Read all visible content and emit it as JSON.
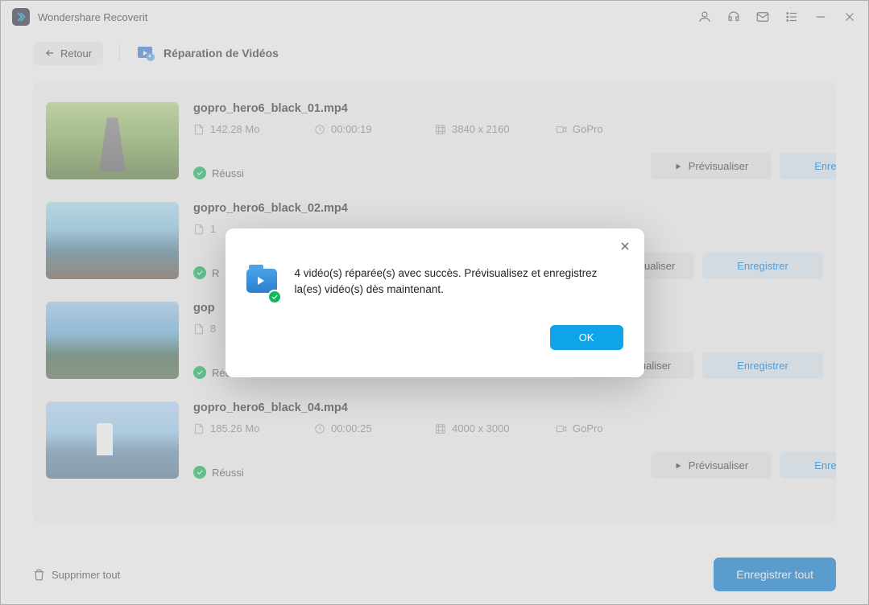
{
  "app": {
    "title": "Wondershare Recoverit"
  },
  "nav": {
    "back": "Retour",
    "title": "Réparation de Vidéos"
  },
  "labels": {
    "preview": "Prévisualiser",
    "save": "Enregistrer",
    "status_success": "Réussi"
  },
  "videos": [
    {
      "name": "gopro_hero6_black_01.mp4",
      "size": "142.28 Mo",
      "duration": "00:00:19",
      "resolution": "3840 x 2160",
      "camera": "GoPro"
    },
    {
      "name": "gopro_hero6_black_02.mp4",
      "size": "1",
      "duration": "",
      "resolution": "",
      "camera": ""
    },
    {
      "name": "gop",
      "size": "8",
      "duration": "",
      "resolution": "",
      "camera": ""
    },
    {
      "name": "gopro_hero6_black_04.mp4",
      "size": "185.26 Mo",
      "duration": "00:00:25",
      "resolution": "4000 x 3000",
      "camera": "GoPro"
    }
  ],
  "footer": {
    "delete_all": "Supprimer tout",
    "save_all": "Enregistrer tout"
  },
  "dialog": {
    "message": "4 vidéo(s) réparée(s) avec succès. Prévisualisez et enregistrez la(es) vidéo(s) dès maintenant.",
    "ok": "OK"
  }
}
